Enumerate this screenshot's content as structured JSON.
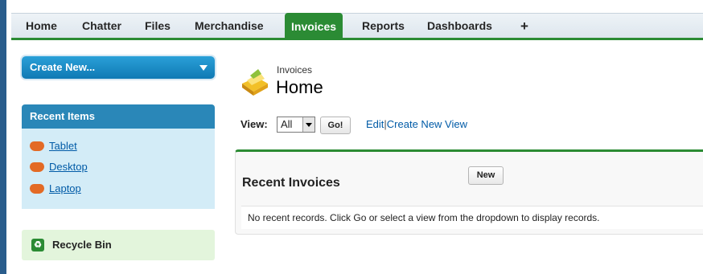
{
  "tabs": [
    {
      "label": "Home",
      "active": false
    },
    {
      "label": "Chatter",
      "active": false
    },
    {
      "label": "Files",
      "active": false
    },
    {
      "label": "Merchandise",
      "active": false
    },
    {
      "label": "Invoices",
      "active": true
    },
    {
      "label": "Reports",
      "active": false
    },
    {
      "label": "Dashboards",
      "active": false
    },
    {
      "label": "+",
      "active": false
    }
  ],
  "sidebar": {
    "create_new_label": "Create New...",
    "recent_items_title": "Recent Items",
    "recent_items": [
      {
        "label": "Tablet",
        "icon": "heart-icon"
      },
      {
        "label": "Desktop",
        "icon": "heart-icon"
      },
      {
        "label": "Laptop",
        "icon": "heart-icon"
      }
    ],
    "recycle_bin_label": "Recycle Bin"
  },
  "header": {
    "object_type": "Invoices",
    "title": "Home"
  },
  "view": {
    "label": "View:",
    "selected": "All",
    "go_label": "Go!",
    "edit_link": "Edit",
    "separator": "|",
    "create_link": "Create New View"
  },
  "panel": {
    "title": "Recent Invoices",
    "new_label": "New",
    "empty_message": "No recent records. Click Go or select a view from the dropdown to display records."
  },
  "colors": {
    "tab_active": "#2b8b34",
    "create_button": "#1a8cc8",
    "recent_header": "#2a87b8",
    "recent_body": "#d3ecf7",
    "recycle_bg": "#e3f5dc",
    "link": "#015ba7"
  }
}
